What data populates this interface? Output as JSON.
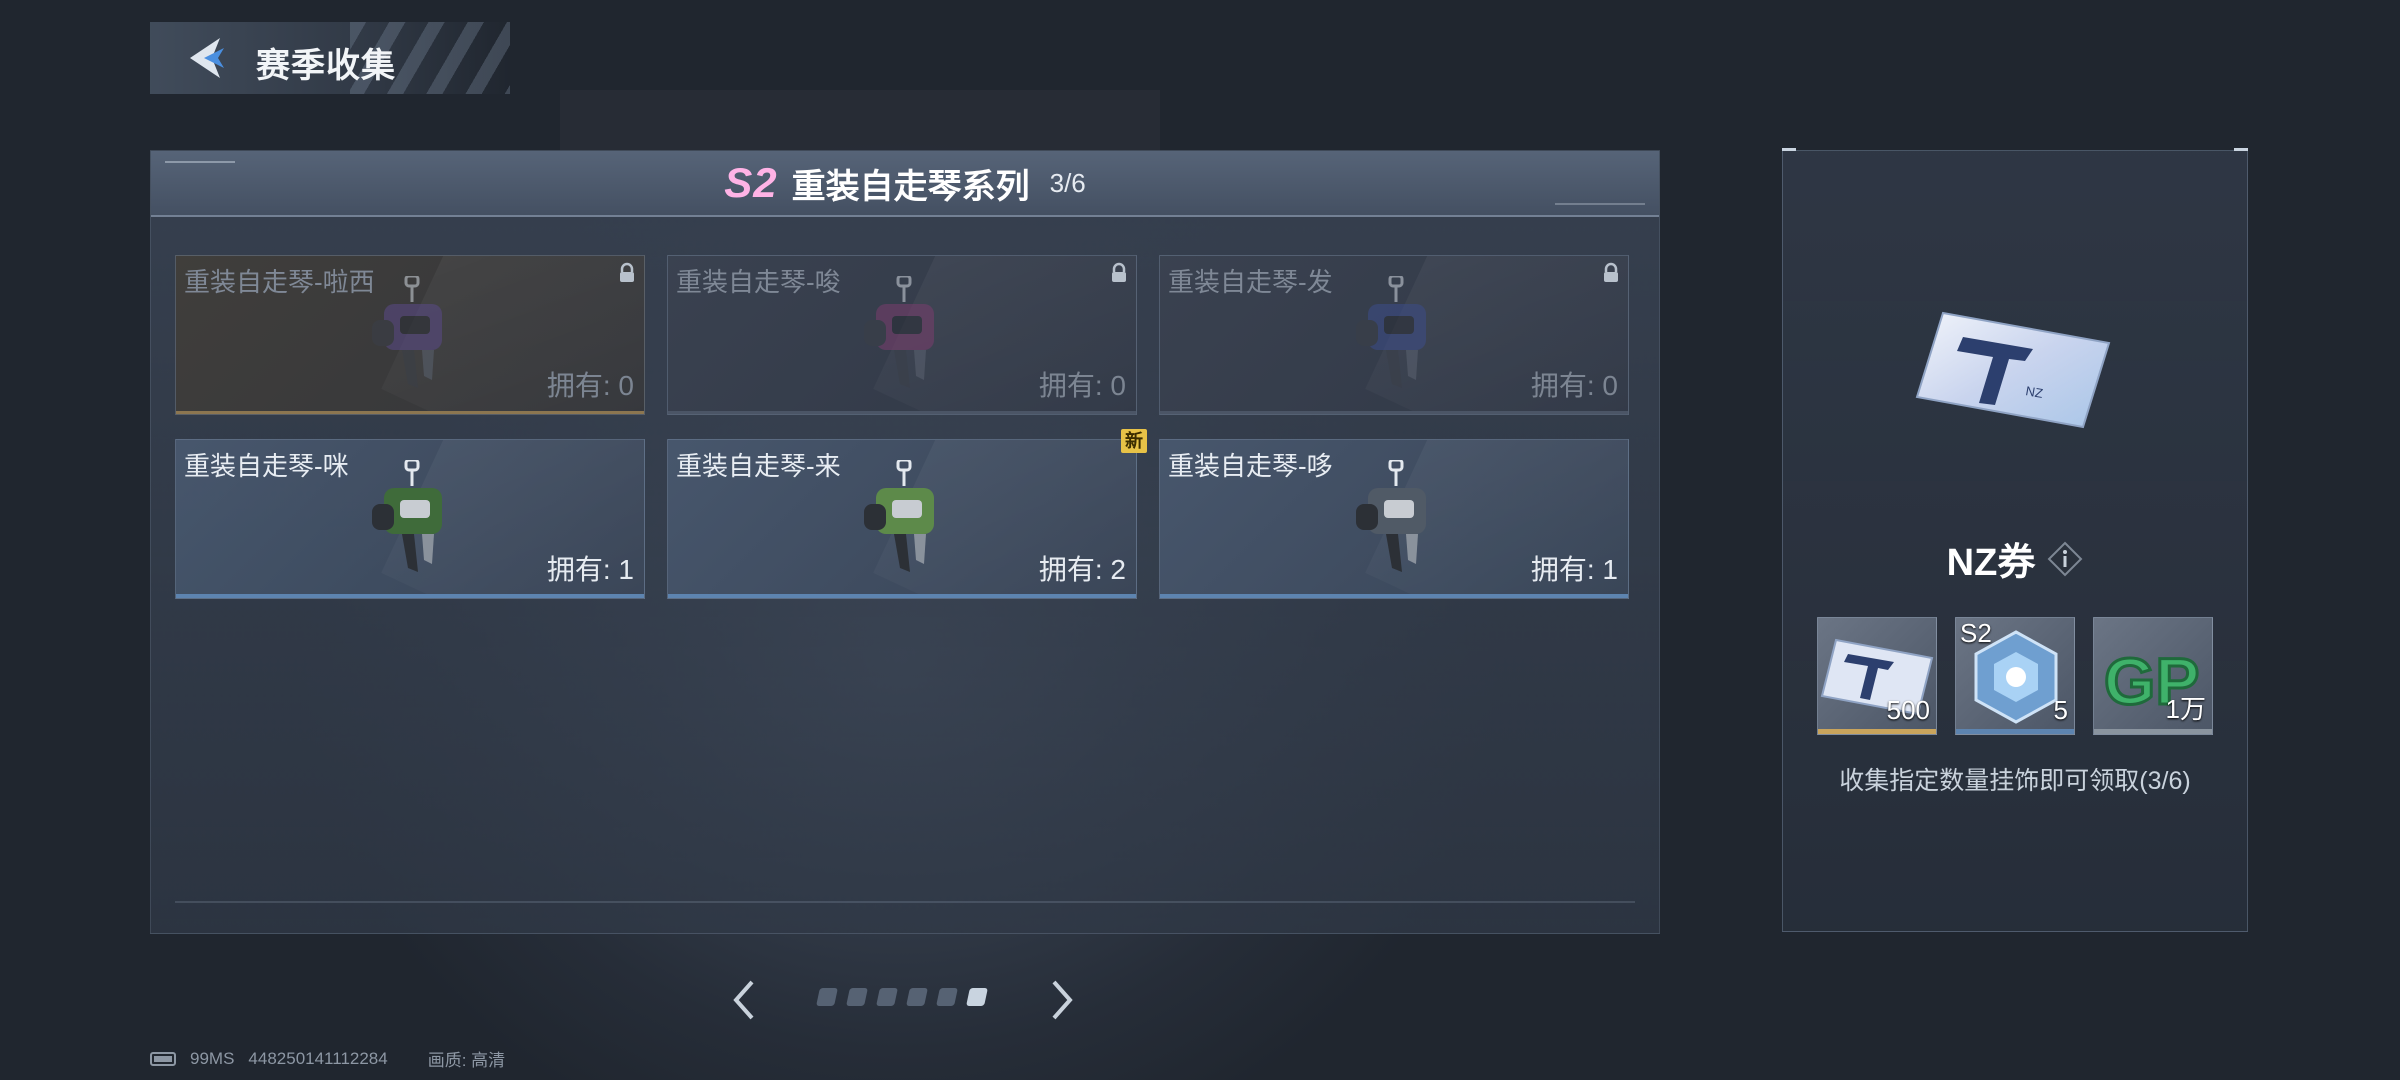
{
  "header": {
    "title": "赛季收集"
  },
  "series": {
    "season_badge": "S2",
    "name": "重装自走琴系列",
    "progress": "3/6"
  },
  "cards": [
    {
      "name": "重装自走琴-啦西",
      "owned": "拥有: 0",
      "locked": true,
      "robot_color": "#6a4f9a"
    },
    {
      "name": "重装自走琴-唆",
      "owned": "拥有: 0",
      "locked": true,
      "robot_color": "#7a3d6e"
    },
    {
      "name": "重装自走琴-发",
      "owned": "拥有: 0",
      "locked": true,
      "robot_color": "#3c4d8a"
    },
    {
      "name": "重装自走琴-咪",
      "owned": "拥有: 1",
      "locked": false,
      "robot_color": "#3f6b3a"
    },
    {
      "name": "重装自走琴-来",
      "owned": "拥有: 2",
      "locked": false,
      "robot_color": "#5d8a4a",
      "badge": "新"
    },
    {
      "name": "重装自走琴-哆",
      "owned": "拥有: 1",
      "locked": false,
      "robot_color": "#505a66"
    }
  ],
  "pager": {
    "total": 6,
    "active_index": 5
  },
  "reward": {
    "name": "NZ券",
    "ticket_text": "NZ",
    "items": [
      {
        "icon": "nz-ticket",
        "qty": "500",
        "bar_color": "#c9a45c"
      },
      {
        "icon": "s2-crystal",
        "tag": "S2",
        "qty": "5",
        "bar_color": "#5d84b0"
      },
      {
        "icon": "gp-coin",
        "icon_text": "GP",
        "qty": "1万",
        "bar_color": "#8a949f"
      }
    ],
    "description": "收集指定数量挂饰即可领取(3/6)"
  },
  "footer": {
    "ping": "99MS",
    "uid": "448250141112284",
    "quality": "画质: 高清"
  },
  "colors": {
    "accent": "#5d84b0",
    "season_pink": "#ffb3e6",
    "new_badge": "#e7c247"
  }
}
